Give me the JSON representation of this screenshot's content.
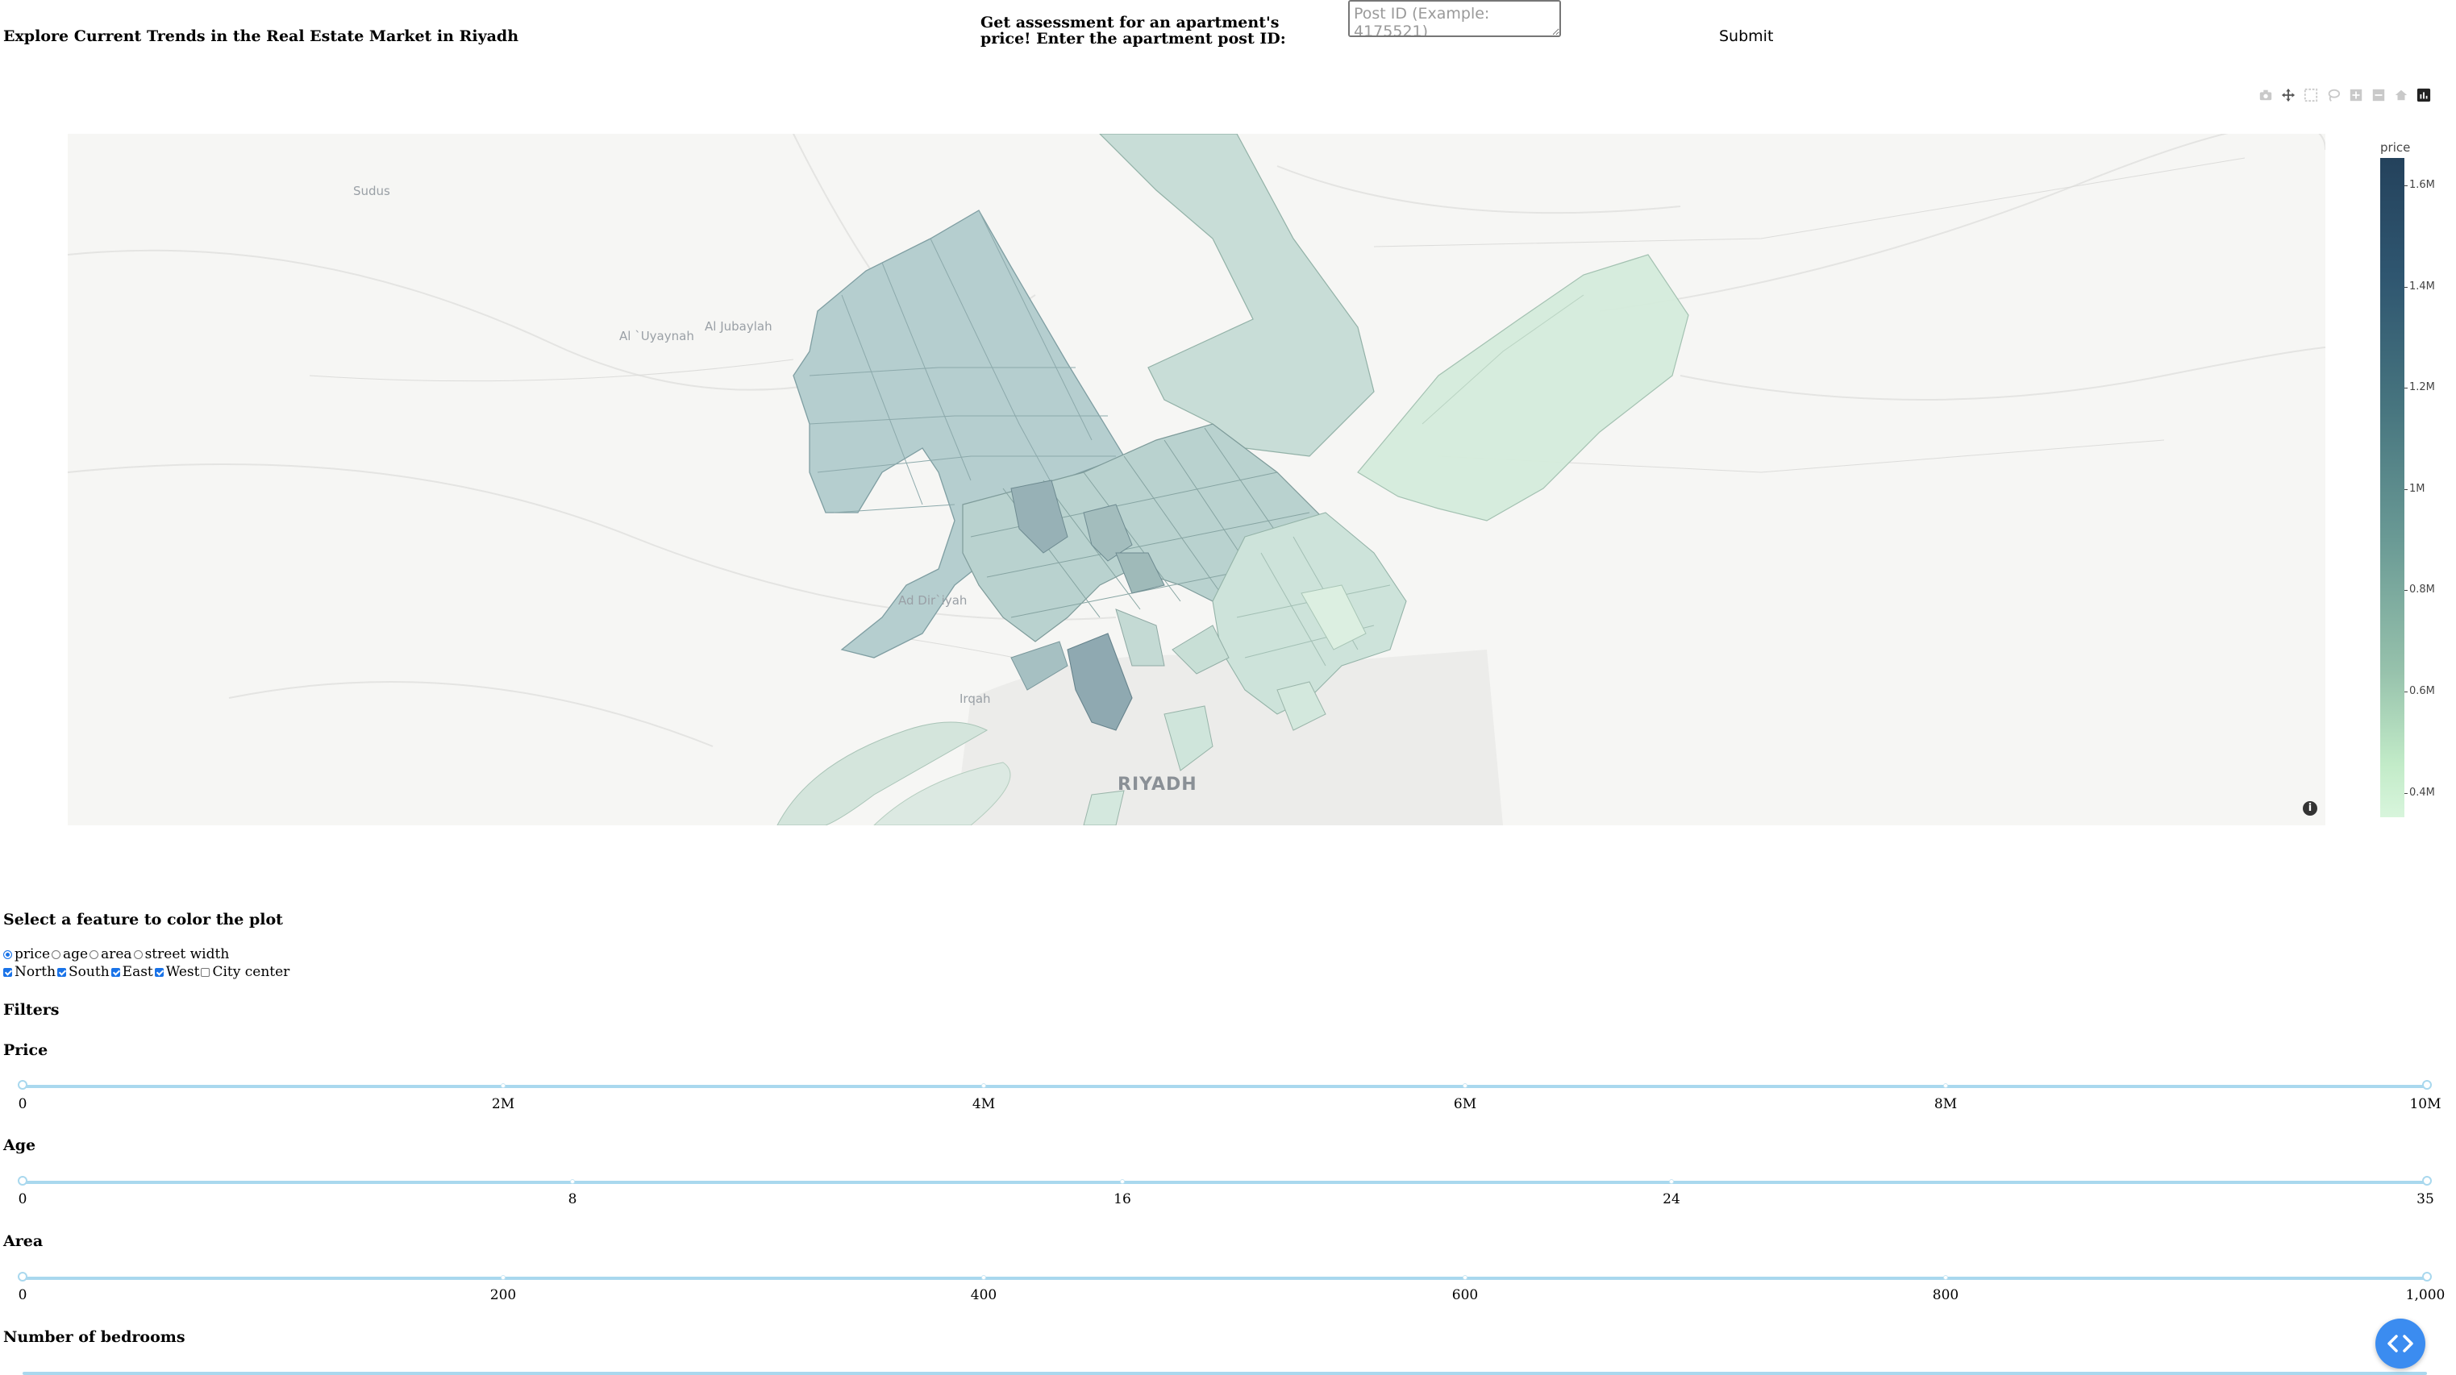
{
  "header": {
    "title": "Explore Current Trends in the Real Estate Market in Riyadh",
    "assess_label": "Get assessment for an apartment's price! Enter the apartment post ID:",
    "postid_placeholder": "Post ID (Example: 4175521)",
    "postid_value": "",
    "submit_label": "Submit"
  },
  "modebar": {
    "icons": [
      "camera-icon",
      "pan-icon",
      "box-select-icon",
      "lasso-icon",
      "zoom-in-icon",
      "zoom-out-icon",
      "reset-home-icon",
      "plotly-logo-icon"
    ]
  },
  "map": {
    "place_labels": [
      "Sudus",
      "Al `Uyaynah",
      "Al Jubaylah",
      "Ad Dir`iyah",
      "Irqah",
      "RIYADH"
    ],
    "colorbar": {
      "title": "price",
      "ticks": [
        "1.6M",
        "1.4M",
        "1.2M",
        "1M",
        "0.8M",
        "0.6M",
        "0.4M"
      ],
      "colors": {
        "high": "#24425c",
        "mid": "#6a9a95",
        "low": "#d8f5dc"
      }
    }
  },
  "color_feature": {
    "heading": "Select a feature to color the plot",
    "options": [
      "price",
      "age",
      "area",
      "street width"
    ],
    "selected": "price"
  },
  "regions": {
    "options": [
      {
        "label": "North",
        "checked": true
      },
      {
        "label": "South",
        "checked": true
      },
      {
        "label": "East",
        "checked": true
      },
      {
        "label": "West",
        "checked": true
      },
      {
        "label": "City center",
        "checked": false
      }
    ]
  },
  "filters": {
    "heading": "Filters",
    "sliders": [
      {
        "label": "Price",
        "marks": [
          "0",
          "2M",
          "4M",
          "6M",
          "8M",
          "10M"
        ],
        "range_fraction": [
          0,
          1
        ]
      },
      {
        "label": "Age",
        "marks": [
          "0",
          "8",
          "16",
          "24",
          "35"
        ],
        "range_fraction": [
          0,
          1
        ]
      },
      {
        "label": "Area",
        "marks": [
          "0",
          "200",
          "400",
          "600",
          "800",
          "1,000"
        ],
        "range_fraction": [
          0,
          1
        ]
      },
      {
        "label": "Number of bedrooms",
        "marks": [],
        "range_fraction": [
          0,
          1
        ]
      }
    ]
  },
  "colors": {
    "accent": "#1a73e8",
    "slider_track": "#a9d8ee",
    "fab": "#3b8cf0"
  }
}
